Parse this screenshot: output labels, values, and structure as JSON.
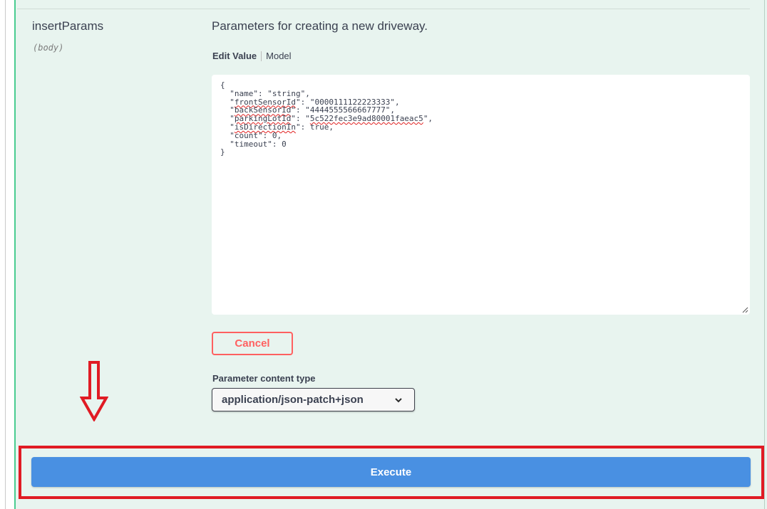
{
  "parameter": {
    "name": "insertParams",
    "location": "(body)",
    "description": "Parameters for creating a new driveway."
  },
  "tabs": {
    "edit_value": "Edit Value",
    "model": "Model"
  },
  "editor": {
    "lines": [
      {
        "parts": [
          {
            "t": "{"
          }
        ]
      },
      {
        "parts": [
          {
            "t": "  \"name\": \"string\","
          }
        ]
      },
      {
        "parts": [
          {
            "t": "  \""
          },
          {
            "t": "frontSensorId",
            "squiggle": true
          },
          {
            "t": "\": \"0000111122223333\","
          }
        ]
      },
      {
        "parts": [
          {
            "t": "  \""
          },
          {
            "t": "backSensorId",
            "squiggle": true
          },
          {
            "t": "\": \"4444555566667777\","
          }
        ]
      },
      {
        "parts": [
          {
            "t": "  \""
          },
          {
            "t": "parkingLotId",
            "squiggle": true
          },
          {
            "t": "\": \""
          },
          {
            "t": "5c522fec3e9ad80001faeac5",
            "squiggle": true
          },
          {
            "t": "\","
          }
        ]
      },
      {
        "parts": [
          {
            "t": "  \""
          },
          {
            "t": "isDirectionIn",
            "squiggle": true
          },
          {
            "t": "\": true,"
          }
        ]
      },
      {
        "parts": [
          {
            "t": "  \"count\": 0,"
          }
        ]
      },
      {
        "parts": [
          {
            "t": "  \"timeout\": 0"
          }
        ]
      },
      {
        "parts": [
          {
            "t": "}"
          }
        ]
      }
    ]
  },
  "buttons": {
    "cancel": "Cancel",
    "execute": "Execute"
  },
  "content_type": {
    "label": "Parameter content type",
    "selected": "application/json-patch+json"
  },
  "colors": {
    "panel_background": "#e8f4ef",
    "cancel_border": "#ff6060",
    "execute_background": "#4990e2",
    "annotation_red": "#e01b24"
  },
  "icons": {
    "dropdown": "chevron-down-icon",
    "annotation_arrow": "arrow-down-outline-icon",
    "resize": "resize-grip-icon"
  }
}
